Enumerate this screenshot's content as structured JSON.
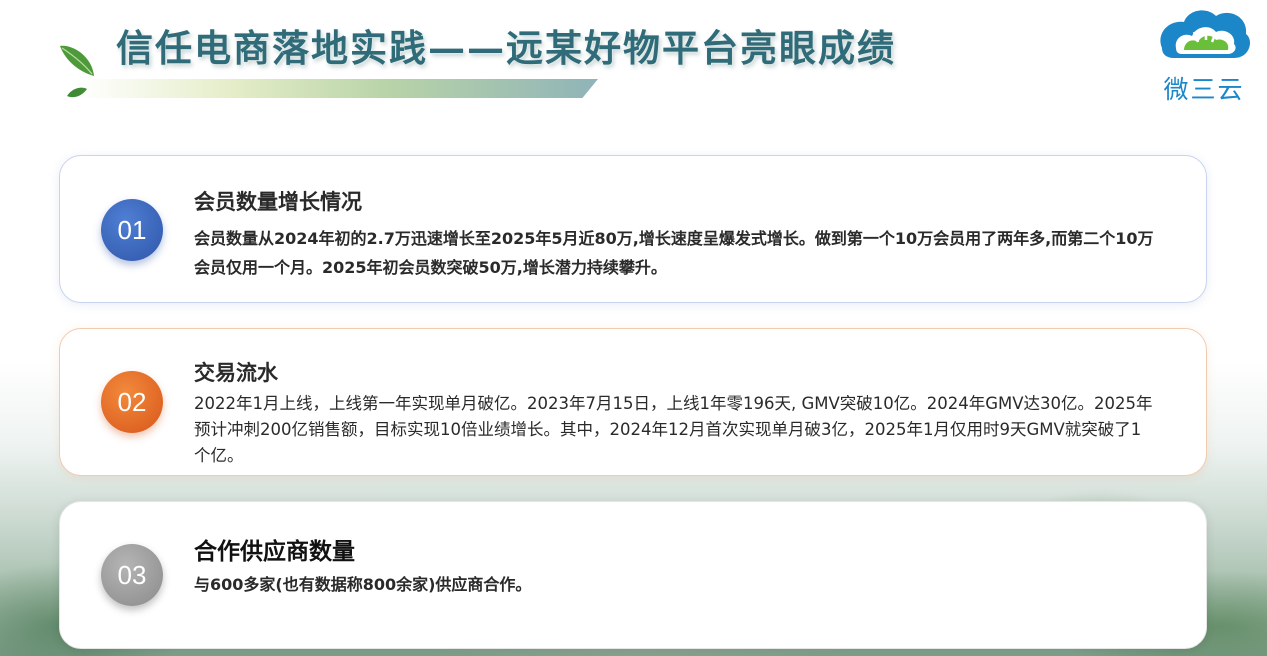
{
  "header": {
    "title": "信任电商落地实践——远某好物平台亮眼成绩"
  },
  "logo": {
    "text": "微三云"
  },
  "cards": [
    {
      "number": "01",
      "title": "会员数量增长情况",
      "body": "会员数量从2024年初的2.7万迅速增长至2025年5月近80万,增长速度呈爆发式增长。做到第一个10万会员用了两年多,而第二个10万会员仅用一个月。2025年初会员数突破50万,增长潜力持续攀升。"
    },
    {
      "number": "02",
      "title": "交易流水",
      "body": "2022年1月上线，上线第一年实现单月破亿。2023年7月15日，上线1年零196天, GMV突破10亿。2024年GMV达30亿。2025年预计冲刺200亿销售额，目标实现10倍业绩增长。其中，2024年12月首次实现单月破3亿，2025年1月仅用时9天GMV就突破了1个亿。"
    },
    {
      "number": "03",
      "title": "合作供应商数量",
      "body": "与600多家(也有数据称800余家)供应商合作。"
    }
  ],
  "colors": {
    "title": "#2f6b78",
    "badge_1": "#3563b8",
    "badge_2": "#e46a26",
    "badge_3": "#9a9a9a",
    "logo_blue": "#1b86c8",
    "logo_green": "#6abf3a"
  },
  "icons": {
    "leaf": "leaf-icon",
    "logo": "cloud-logo-icon"
  }
}
